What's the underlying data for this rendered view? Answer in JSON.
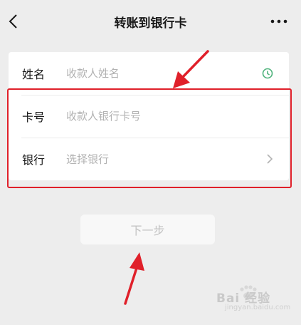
{
  "header": {
    "title": "转账到银行卡",
    "back_icon": "chevron-left-icon",
    "more_icon": "ellipsis-icon"
  },
  "form": {
    "name": {
      "label": "姓名",
      "placeholder": "收款人姓名",
      "icon": "clock-icon"
    },
    "card_number": {
      "label": "卡号",
      "placeholder": "收款人银行卡号"
    },
    "bank": {
      "label": "银行",
      "placeholder": "选择银行",
      "icon": "chevron-right-icon"
    }
  },
  "next_button": {
    "label": "下一步"
  },
  "annotations": {
    "highlight_color": "#e0202a",
    "arrow_color": "#e0202a"
  },
  "watermark": {
    "text": "Bai 经验",
    "sub": "jingyan.baidu.com"
  },
  "colors": {
    "accent_green": "#4fb37c",
    "background": "#ededed"
  }
}
